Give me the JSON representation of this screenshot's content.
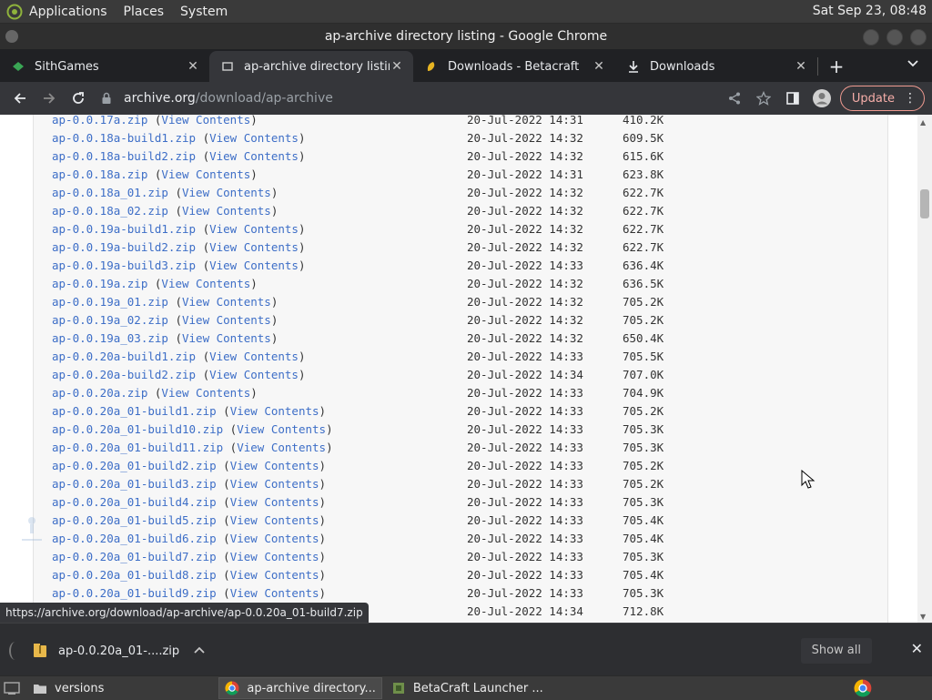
{
  "topbar": {
    "menus": [
      "Applications",
      "Places",
      "System"
    ],
    "clock": "Sat Sep 23, 08:48"
  },
  "window": {
    "title": "ap-archive directory listing - Google Chrome"
  },
  "tabs": [
    {
      "label": "SithGames",
      "icon": "sithgames-icon",
      "active": false
    },
    {
      "label": "ap-archive directory listing",
      "icon": "archive-icon",
      "active": true
    },
    {
      "label": "Downloads - Betacraft",
      "icon": "betacraft-icon",
      "active": false
    },
    {
      "label": "Downloads",
      "icon": "download-icon",
      "active": false
    }
  ],
  "toolbar": {
    "url_host": "archive.org",
    "url_path": "/download/ap-archive",
    "update_label": "Update"
  },
  "files": [
    {
      "name": "ap-0.0.17a.zip",
      "view": "View Contents",
      "date": "20-Jul-2022 14:31",
      "size": "410.2K"
    },
    {
      "name": "ap-0.0.18a-build1.zip",
      "view": "View Contents",
      "date": "20-Jul-2022 14:32",
      "size": "609.5K"
    },
    {
      "name": "ap-0.0.18a-build2.zip",
      "view": "View Contents",
      "date": "20-Jul-2022 14:32",
      "size": "615.6K"
    },
    {
      "name": "ap-0.0.18a.zip",
      "view": "View Contents",
      "date": "20-Jul-2022 14:31",
      "size": "623.8K"
    },
    {
      "name": "ap-0.0.18a_01.zip",
      "view": "View Contents",
      "date": "20-Jul-2022 14:32",
      "size": "622.7K"
    },
    {
      "name": "ap-0.0.18a_02.zip",
      "view": "View Contents",
      "date": "20-Jul-2022 14:32",
      "size": "622.7K"
    },
    {
      "name": "ap-0.0.19a-build1.zip",
      "view": "View Contents",
      "date": "20-Jul-2022 14:32",
      "size": "622.7K"
    },
    {
      "name": "ap-0.0.19a-build2.zip",
      "view": "View Contents",
      "date": "20-Jul-2022 14:32",
      "size": "622.7K"
    },
    {
      "name": "ap-0.0.19a-build3.zip",
      "view": "View Contents",
      "date": "20-Jul-2022 14:33",
      "size": "636.4K"
    },
    {
      "name": "ap-0.0.19a.zip",
      "view": "View Contents",
      "date": "20-Jul-2022 14:32",
      "size": "636.5K"
    },
    {
      "name": "ap-0.0.19a_01.zip",
      "view": "View Contents",
      "date": "20-Jul-2022 14:32",
      "size": "705.2K"
    },
    {
      "name": "ap-0.0.19a_02.zip",
      "view": "View Contents",
      "date": "20-Jul-2022 14:32",
      "size": "705.2K"
    },
    {
      "name": "ap-0.0.19a_03.zip",
      "view": "View Contents",
      "date": "20-Jul-2022 14:32",
      "size": "650.4K"
    },
    {
      "name": "ap-0.0.20a-build1.zip",
      "view": "View Contents",
      "date": "20-Jul-2022 14:33",
      "size": "705.5K"
    },
    {
      "name": "ap-0.0.20a-build2.zip",
      "view": "View Contents",
      "date": "20-Jul-2022 14:34",
      "size": "707.0K"
    },
    {
      "name": "ap-0.0.20a.zip",
      "view": "View Contents",
      "date": "20-Jul-2022 14:33",
      "size": "704.9K"
    },
    {
      "name": "ap-0.0.20a_01-build1.zip",
      "view": "View Contents",
      "date": "20-Jul-2022 14:33",
      "size": "705.2K"
    },
    {
      "name": "ap-0.0.20a_01-build10.zip",
      "view": "View Contents",
      "date": "20-Jul-2022 14:33",
      "size": "705.3K"
    },
    {
      "name": "ap-0.0.20a_01-build11.zip",
      "view": "View Contents",
      "date": "20-Jul-2022 14:33",
      "size": "705.3K"
    },
    {
      "name": "ap-0.0.20a_01-build2.zip",
      "view": "View Contents",
      "date": "20-Jul-2022 14:33",
      "size": "705.2K"
    },
    {
      "name": "ap-0.0.20a_01-build3.zip",
      "view": "View Contents",
      "date": "20-Jul-2022 14:33",
      "size": "705.2K"
    },
    {
      "name": "ap-0.0.20a_01-build4.zip",
      "view": "View Contents",
      "date": "20-Jul-2022 14:33",
      "size": "705.3K"
    },
    {
      "name": "ap-0.0.20a_01-build5.zip",
      "view": "View Contents",
      "date": "20-Jul-2022 14:33",
      "size": "705.4K"
    },
    {
      "name": "ap-0.0.20a_01-build6.zip",
      "view": "View Contents",
      "date": "20-Jul-2022 14:33",
      "size": "705.4K"
    },
    {
      "name": "ap-0.0.20a_01-build7.zip",
      "view": "View Contents",
      "date": "20-Jul-2022 14:33",
      "size": "705.3K"
    },
    {
      "name": "ap-0.0.20a_01-build8.zip",
      "view": "View Contents",
      "date": "20-Jul-2022 14:33",
      "size": "705.4K"
    },
    {
      "name": "ap-0.0.20a_01-build9.zip",
      "view": "View Contents",
      "date": "20-Jul-2022 14:33",
      "size": "705.3K"
    },
    {
      "name": "",
      "view": "",
      "date": "20-Jul-2022 14:34",
      "size": "712.8K"
    }
  ],
  "status_url": "https://archive.org/download/ap-archive/ap-0.0.20a_01-build7.zip",
  "download_bar": {
    "file_label": "ap-0.0.20a_01-....zip",
    "show_all": "Show all"
  },
  "taskbar": {
    "items": [
      {
        "label": "versions",
        "icon": "folder-icon"
      },
      {
        "label": "ap-archive directory...",
        "icon": "chrome-icon"
      },
      {
        "label": "BetaCraft Launcher ...",
        "icon": "betacraft-icon"
      }
    ]
  }
}
